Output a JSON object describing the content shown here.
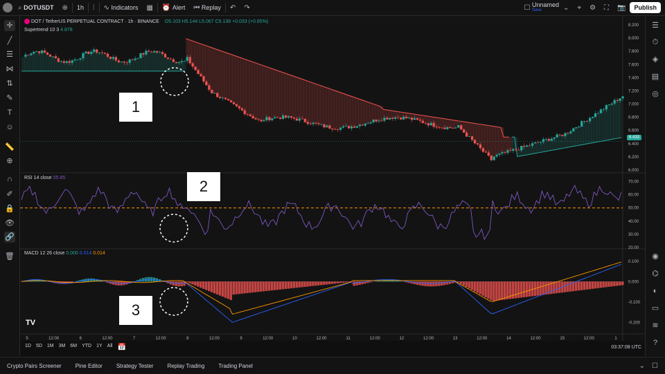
{
  "topbar": {
    "symbol": "DOTUSDT",
    "interval": "1h",
    "indicators": "Indicators",
    "alert": "Alert",
    "replay": "Replay",
    "layout_name": "Unnamed",
    "layout_sub": "Save",
    "publish": "Publish"
  },
  "legend": {
    "title": "DOT / TetherUS PERPETUAL CONTRACT · 1h · BINANCE",
    "ohlc": "O5.103 H5.144 L5.067 C5.136 +0.033 (+0.65%)",
    "supertrend": "Supertrend 10 3",
    "supertrend_val": "4.878",
    "rsi": "RSI 14 close",
    "rsi_val": "55.85",
    "macd": "MACD 12 26 close",
    "macd_v1": "0.000",
    "macd_v2": "0.014",
    "macd_v3": "0.014"
  },
  "callouts": [
    "1",
    "2",
    "3"
  ],
  "price_axis": [
    "8.200",
    "8.000",
    "7.800",
    "7.600",
    "7.400",
    "7.200",
    "7.000",
    "6.800",
    "6.600",
    "6.400",
    "6.200",
    "6.000"
  ],
  "price_current": "6.433",
  "rsi_axis": [
    "70.00",
    "60.00",
    "50.00",
    "40.00",
    "30.00",
    "20.00"
  ],
  "macd_axis": [
    "0.100",
    "0.000",
    "-0.100",
    "-0.200"
  ],
  "time_axis": [
    "5",
    "12:00",
    "6",
    "12:00",
    "7",
    "12:00",
    "8",
    "12:00",
    "9",
    "12:00",
    "10",
    "12:00",
    "11",
    "12:00",
    "12",
    "12:00",
    "13",
    "12:00",
    "14",
    "12:00",
    "15",
    "12:00",
    "1"
  ],
  "timeframes": [
    "1D",
    "5D",
    "1M",
    "3M",
    "6M",
    "YTD",
    "1Y",
    "All"
  ],
  "timestamp": "03:37:08 UTC",
  "bottom_tabs": [
    "Crypto Pairs Screener",
    "Pine Editor",
    "Strategy Tester",
    "Replay Trading",
    "Trading Panel"
  ],
  "colors": {
    "up": "#26a69a",
    "down": "#ef5350",
    "rsi": "#7e57c2",
    "macd": "#2962ff",
    "signal": "#ff9800",
    "supertrend_up": "#26a69a",
    "supertrend_down": "#ef5350"
  }
}
